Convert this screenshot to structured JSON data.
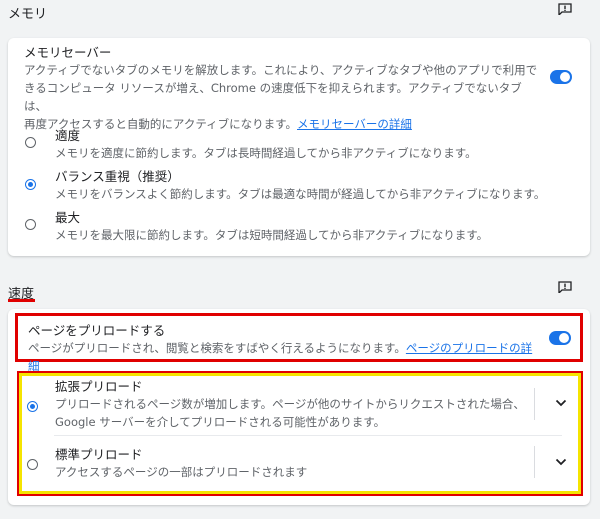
{
  "memory": {
    "section_title": "メモリ",
    "saver_title": "メモリセーバー",
    "saver_desc_1": "アクティブでないタブのメモリを解放します。これにより、アクティブなタブや他のアプリで利用で",
    "saver_desc_2": "きるコンピュータ リソースが増え、Chrome の速度低下を抑えられます。アクティブでないタブは、",
    "saver_desc_3": "再度アクセスすると自動的にアクティブになります。",
    "saver_link": "メモリセーバーの詳細",
    "saver_enabled": true,
    "options": [
      {
        "label": "適度",
        "desc": "メモリを適度に節約します。タブは長時間経過してから非アクティブになります。",
        "selected": false
      },
      {
        "label": "バランス重視（推奨）",
        "desc": "メモリをバランスよく節約します。タブは最適な時間が経過してから非アクティブになります。",
        "selected": true
      },
      {
        "label": "最大",
        "desc": "メモリを最大限に節約します。タブは短時間経過してから非アクティブになります。",
        "selected": false
      }
    ]
  },
  "speed": {
    "section_title": "速度",
    "preload_title": "ページをプリロードする",
    "preload_desc": "ページがプリロードされ、閲覧と検索をすばやく行えるようになります。",
    "preload_link": "ページのプリロードの詳細",
    "preload_enabled": true,
    "options": [
      {
        "label": "拡張プリロード",
        "desc_1": "プリロードされるページ数が増加します。ページが他のサイトからリクエストされた場合、",
        "desc_2": "Google サーバーを介してプリロードされる可能性があります。",
        "selected": true
      },
      {
        "label": "標準プリロード",
        "desc_1": "アクセスするページの一部はプリロードされます",
        "desc_2": "",
        "selected": false
      }
    ]
  },
  "colors": {
    "accent": "#1a73e8",
    "highlight_red": "#e00000",
    "highlight_yellow": "#f5e400"
  },
  "icons": [
    "feedback-icon",
    "chevron-down-icon"
  ]
}
